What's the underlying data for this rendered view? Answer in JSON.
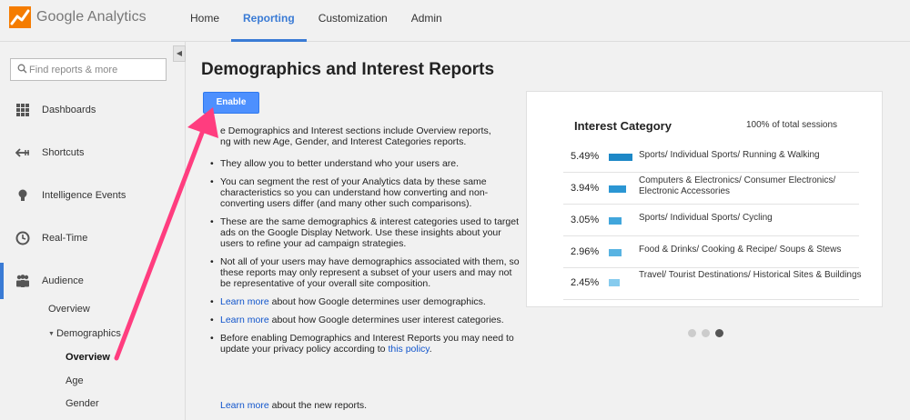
{
  "app": {
    "name": "Google Analytics"
  },
  "topnav": [
    {
      "label": "Home",
      "active": false
    },
    {
      "label": "Reporting",
      "active": true
    },
    {
      "label": "Customization",
      "active": false
    },
    {
      "label": "Admin",
      "active": false
    }
  ],
  "sidebar": {
    "search_placeholder": "Find reports & more",
    "items": [
      {
        "label": "Dashboards",
        "icon": "grid-icon"
      },
      {
        "label": "Shortcuts",
        "icon": "shortcut-arrow-icon"
      },
      {
        "label": "Intelligence Events",
        "icon": "lightbulb-icon"
      },
      {
        "label": "Real-Time",
        "icon": "clock-icon"
      },
      {
        "label": "Audience",
        "icon": "people-icon"
      }
    ],
    "audience_sub": {
      "overview": "Overview",
      "demographics": "Demographics",
      "demo_overview": "Overview",
      "age": "Age",
      "gender": "Gender"
    }
  },
  "main": {
    "title": "Demographics and Interest Reports",
    "enable_label": "Enable",
    "desc_1": "e Demographics and Interest sections include Overview reports,",
    "desc_2": "ng with new Age, Gender, and Interest Categories reports.",
    "b1": "They allow you to better understand who your users are.",
    "b2": "You can segment the rest of your Analytics data by these same characteristics so you can understand how converting and non-converting users differ (and many other such comparisons).",
    "b3": "These are the same demographics & interest categories used to target ads on the Google Display Network. Use these insights about your users to refine your ad campaign strategies.",
    "b4": "Not all of your users may have demographics associated with them, so these reports may only represent a subset of your users and may not be representative of your overall site composition.",
    "learn_more": "Learn more",
    "b5_rest": " about how Google determines user demographics.",
    "b6_rest": " about how Google determines user interest categories.",
    "b7_pre": "Before enabling Demographics and Interest Reports you may need to update your privacy policy according to ",
    "b7_link": "this policy",
    "b7_post": ".",
    "final_rest": " about the new reports."
  },
  "card": {
    "title": "Interest Category",
    "subtitle": "100% of total sessions",
    "rows": [
      {
        "pct": "5.49%",
        "category": "Sports/ Individual Sports/ Running & Walking",
        "value": 5.49,
        "color": "#1d88c7"
      },
      {
        "pct": "3.94%",
        "category": "Computers & Electronics/ Consumer Electronics/ Electronic Accessories",
        "value": 3.94,
        "color": "#2b96d3"
      },
      {
        "pct": "3.05%",
        "category": "Sports/ Individual Sports/ Cycling",
        "value": 3.05,
        "color": "#41a6dc"
      },
      {
        "pct": "2.96%",
        "category": "Food & Drinks/ Cooking & Recipe/ Soups & Stews",
        "value": 2.96,
        "color": "#58b3e2"
      },
      {
        "pct": "2.45%",
        "category": "Travel/ Tourist Destinations/ Historical Sites & Buildings",
        "value": 2.45,
        "color": "#86cbee"
      }
    ],
    "carousel_active": 3
  },
  "colors": {
    "accent": "#3a7bd5",
    "button": "#4d90fe",
    "arrow": "#ff3d7f"
  }
}
